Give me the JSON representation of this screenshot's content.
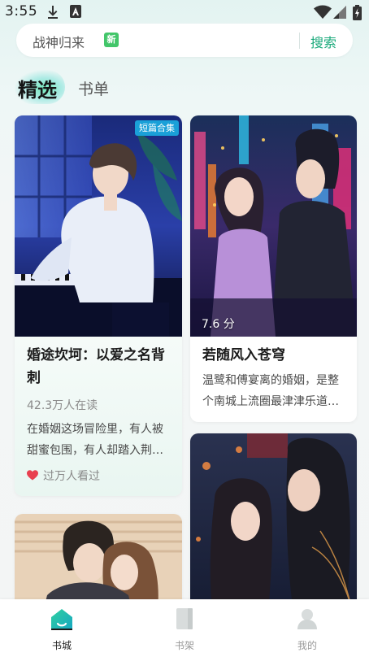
{
  "status_bar": {
    "time": "3:55",
    "icons": [
      "download-icon",
      "font-icon",
      "wifi-icon",
      "signal-icon",
      "battery-charging-icon"
    ]
  },
  "search": {
    "hint": "战神归来",
    "badge": "新",
    "button_label": "搜索"
  },
  "tabs": [
    {
      "label": "精选",
      "selected": true
    },
    {
      "label": "书单",
      "selected": false
    }
  ],
  "books": [
    {
      "title_line1": "婚途坎坷：以爱之名背",
      "title_line2": "刺",
      "tag": "短篇合集",
      "readers": "42.3万人在读",
      "desc_line1": "在婚姻这场冒险里，有人被",
      "desc_line2": "甜蜜包围，有人却踏入荆…",
      "hot_text": "过万人看过"
    },
    {
      "title": "若随风入苍穹",
      "rating": "7.6 分",
      "desc_line1": "温鹭和傅宴离的婚姻，是整",
      "desc_line2": "个南城上流圈最津津乐道…"
    },
    {
      "cover": "couple-embrace-window-cover"
    },
    {
      "cover": "couple-night-city-cover"
    }
  ],
  "bottom_nav": [
    {
      "label": "书城",
      "icon": "home-icon",
      "active": true
    },
    {
      "label": "书架",
      "icon": "bookshelf-icon",
      "active": false
    },
    {
      "label": "我的",
      "icon": "profile-icon",
      "active": false
    }
  ],
  "colors": {
    "accent": "#19a97a",
    "badge_green": "#43c66a",
    "tag_blue": "#1aa0d8",
    "heart": "#e8404f"
  }
}
